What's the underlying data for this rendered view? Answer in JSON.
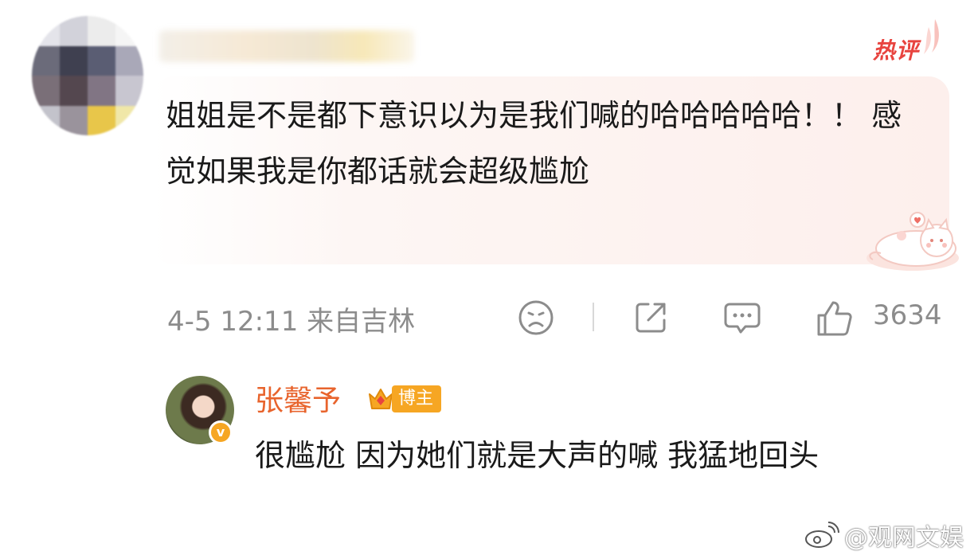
{
  "comment": {
    "text": "姐姐是不是都下意识以为是我们喊的哈哈哈哈哈！！ 感觉如果我是你都话就会超级尴尬",
    "hot_badge": "热评",
    "time": "4-5 12:11",
    "location": "来自吉林",
    "like_count": "3634",
    "icons": [
      "sad-face-icon",
      "share-icon",
      "comment-icon",
      "thumbs-up-icon"
    ]
  },
  "reply": {
    "author": "张馨予",
    "badge": "博主",
    "text": "很尴尬 因为她们就是大声的喊 我猛地回头"
  },
  "watermark": "@观网文娱",
  "colors": {
    "hot_red": "#e8443f",
    "author_orange": "#e8642d",
    "badge_gold": "#f6a623",
    "meta_gray": "#8c8c8c",
    "bubble_pink": "#fdefec"
  }
}
